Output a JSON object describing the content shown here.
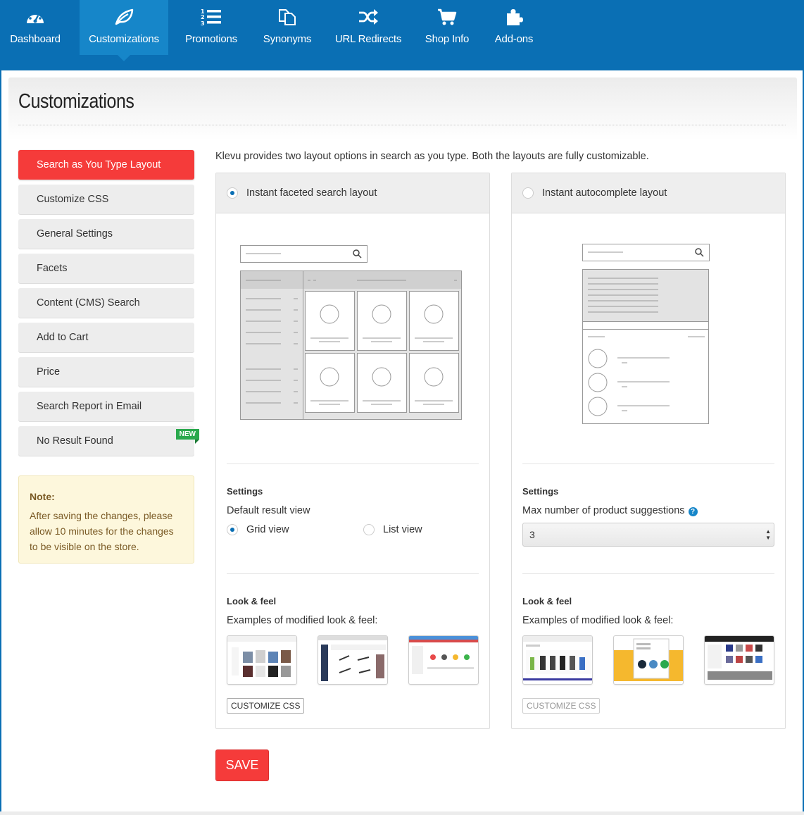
{
  "nav": {
    "items": [
      {
        "label": "Dashboard",
        "icon": "dashboard-icon"
      },
      {
        "label": "Customizations",
        "icon": "leaf-icon"
      },
      {
        "label": "Promotions",
        "icon": "numbered-list-icon"
      },
      {
        "label": "Synonyms",
        "icon": "copy-icon"
      },
      {
        "label": "URL Redirects",
        "icon": "shuffle-icon"
      },
      {
        "label": "Shop Info",
        "icon": "cart-icon"
      },
      {
        "label": "Add-ons",
        "icon": "puzzle-icon"
      }
    ],
    "active": "Customizations"
  },
  "page": {
    "title": "Customizations"
  },
  "sidebar": {
    "items": [
      {
        "label": "Search as You Type Layout",
        "active": true
      },
      {
        "label": "Customize CSS"
      },
      {
        "label": "General Settings"
      },
      {
        "label": "Facets"
      },
      {
        "label": "Content (CMS) Search"
      },
      {
        "label": "Add to Cart"
      },
      {
        "label": "Price"
      },
      {
        "label": "Search Report in Email"
      },
      {
        "label": "No Result Found",
        "badge": "NEW"
      }
    ]
  },
  "note": {
    "title": "Note:",
    "text": "After saving the changes, please allow 10 minutes for the changes to be visible on the store."
  },
  "main": {
    "intro": "Klevu provides two layout options in search as you type. Both the layouts are fully customizable.",
    "faceted": {
      "title": "Instant faceted search layout",
      "selected": true,
      "settings_title": "Settings",
      "default_view_label": "Default result view",
      "grid_label": "Grid view",
      "list_label": "List view",
      "selected_view": "Grid view",
      "look_title": "Look & feel",
      "look_text": "Examples of modified look & feel:",
      "css_button": "CUSTOMIZE CSS"
    },
    "autocomplete": {
      "title": "Instant autocomplete layout",
      "selected": false,
      "settings_title": "Settings",
      "max_label": "Max number of product suggestions",
      "max_value": "3",
      "look_title": "Look & feel",
      "look_text": "Examples of modified look & feel:",
      "css_button": "CUSTOMIZE CSS"
    },
    "save_label": "SAVE"
  },
  "colors": {
    "nav_bg": "#0a6fb4",
    "nav_active": "#1686c9",
    "accent_red": "#f53b3a",
    "badge_green": "#2aa94d"
  }
}
